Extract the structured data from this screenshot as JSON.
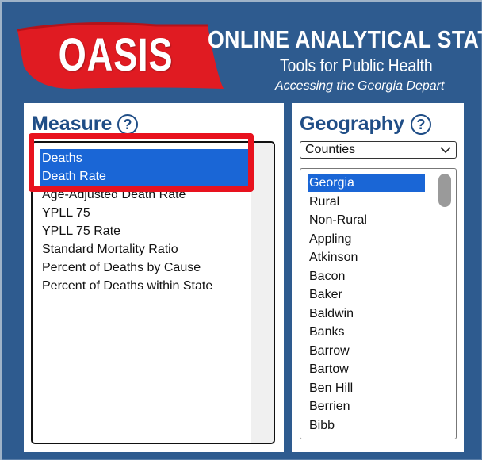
{
  "header": {
    "logo": "OASIS",
    "title_line1": "ONLINE ANALYTICAL STAT",
    "title_line2": "Tools for Public Health",
    "title_line3": "Accessing the Georgia Depart"
  },
  "colors": {
    "background": "#2e5b8f",
    "title_blue": "#1f4d86",
    "selection": "#1a66d6",
    "highlight_red": "#e8121e",
    "logo_red": "#e01b22"
  },
  "measure": {
    "title": "Measure",
    "help_icon_text": "?",
    "items": [
      {
        "label": "Deaths",
        "selected": true
      },
      {
        "label": "Death Rate",
        "selected": true
      },
      {
        "label": "Age-Adjusted Death Rate",
        "selected": false
      },
      {
        "label": "YPLL 75",
        "selected": false
      },
      {
        "label": "YPLL 75 Rate",
        "selected": false
      },
      {
        "label": "Standard Mortality Ratio",
        "selected": false
      },
      {
        "label": "Percent of Deaths by Cause",
        "selected": false
      },
      {
        "label": "Percent of Deaths within State",
        "selected": false
      }
    ]
  },
  "geography": {
    "title": "Geography",
    "help_icon_text": "?",
    "dropdown_value": "Counties",
    "items": [
      {
        "label": "Georgia",
        "selected": true
      },
      {
        "label": "Rural",
        "selected": false
      },
      {
        "label": "Non-Rural",
        "selected": false
      },
      {
        "label": "Appling",
        "selected": false
      },
      {
        "label": "Atkinson",
        "selected": false
      },
      {
        "label": "Bacon",
        "selected": false
      },
      {
        "label": "Baker",
        "selected": false
      },
      {
        "label": "Baldwin",
        "selected": false
      },
      {
        "label": "Banks",
        "selected": false
      },
      {
        "label": "Barrow",
        "selected": false
      },
      {
        "label": "Bartow",
        "selected": false
      },
      {
        "label": "Ben Hill",
        "selected": false
      },
      {
        "label": "Berrien",
        "selected": false
      },
      {
        "label": "Bibb",
        "selected": false
      }
    ]
  }
}
